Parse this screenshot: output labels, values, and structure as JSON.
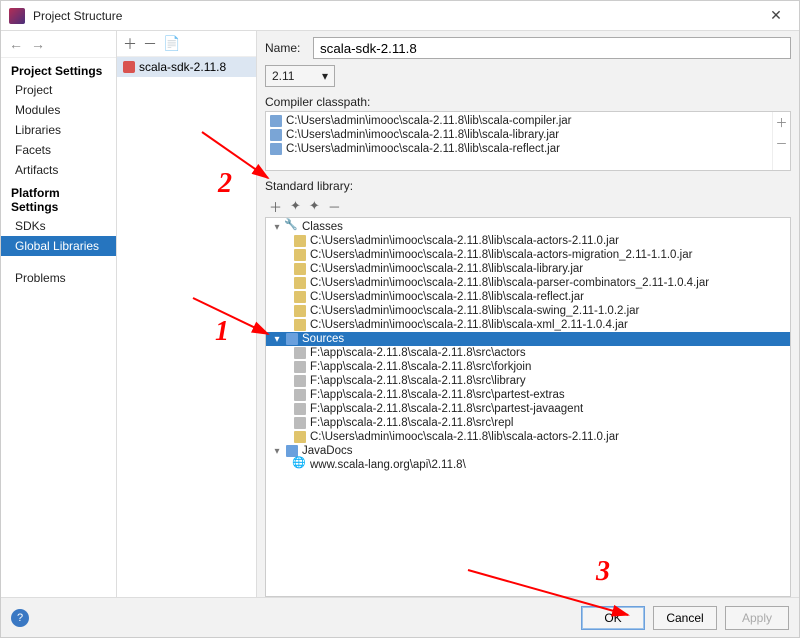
{
  "window": {
    "title": "Project Structure"
  },
  "nav": {
    "section1": "Project Settings",
    "items1": [
      "Project",
      "Modules",
      "Libraries",
      "Facets",
      "Artifacts"
    ],
    "section2": "Platform Settings",
    "items2": [
      "SDKs",
      "Global Libraries"
    ],
    "problems": "Problems"
  },
  "midlist": {
    "item0": "scala-sdk-2.11.8"
  },
  "form": {
    "name_label": "Name:",
    "name_value": "scala-sdk-2.11.8",
    "version": "2.11",
    "compiler_label": "Compiler classpath:",
    "stdlib_label": "Standard library:"
  },
  "classpath": [
    "C:\\Users\\admin\\imooc\\scala-2.11.8\\lib\\scala-compiler.jar",
    "C:\\Users\\admin\\imooc\\scala-2.11.8\\lib\\scala-library.jar",
    "C:\\Users\\admin\\imooc\\scala-2.11.8\\lib\\scala-reflect.jar"
  ],
  "tree": {
    "classes_label": "Classes",
    "classes": [
      "C:\\Users\\admin\\imooc\\scala-2.11.8\\lib\\scala-actors-2.11.0.jar",
      "C:\\Users\\admin\\imooc\\scala-2.11.8\\lib\\scala-actors-migration_2.11-1.1.0.jar",
      "C:\\Users\\admin\\imooc\\scala-2.11.8\\lib\\scala-library.jar",
      "C:\\Users\\admin\\imooc\\scala-2.11.8\\lib\\scala-parser-combinators_2.11-1.0.4.jar",
      "C:\\Users\\admin\\imooc\\scala-2.11.8\\lib\\scala-reflect.jar",
      "C:\\Users\\admin\\imooc\\scala-2.11.8\\lib\\scala-swing_2.11-1.0.2.jar",
      "C:\\Users\\admin\\imooc\\scala-2.11.8\\lib\\scala-xml_2.11-1.0.4.jar"
    ],
    "sources_label": "Sources",
    "sources": [
      "F:\\app\\scala-2.11.8\\scala-2.11.8\\src\\actors",
      "F:\\app\\scala-2.11.8\\scala-2.11.8\\src\\forkjoin",
      "F:\\app\\scala-2.11.8\\scala-2.11.8\\src\\library",
      "F:\\app\\scala-2.11.8\\scala-2.11.8\\src\\partest-extras",
      "F:\\app\\scala-2.11.8\\scala-2.11.8\\src\\partest-javaagent",
      "F:\\app\\scala-2.11.8\\scala-2.11.8\\src\\repl",
      "C:\\Users\\admin\\imooc\\scala-2.11.8\\lib\\scala-actors-2.11.0.jar"
    ],
    "javadocs_label": "JavaDocs",
    "javadocs": [
      "www.scala-lang.org\\api\\2.11.8\\"
    ]
  },
  "footer": {
    "ok": "OK",
    "cancel": "Cancel",
    "apply": "Apply"
  },
  "annotations": {
    "n1": "1",
    "n2": "2",
    "n3": "3"
  }
}
